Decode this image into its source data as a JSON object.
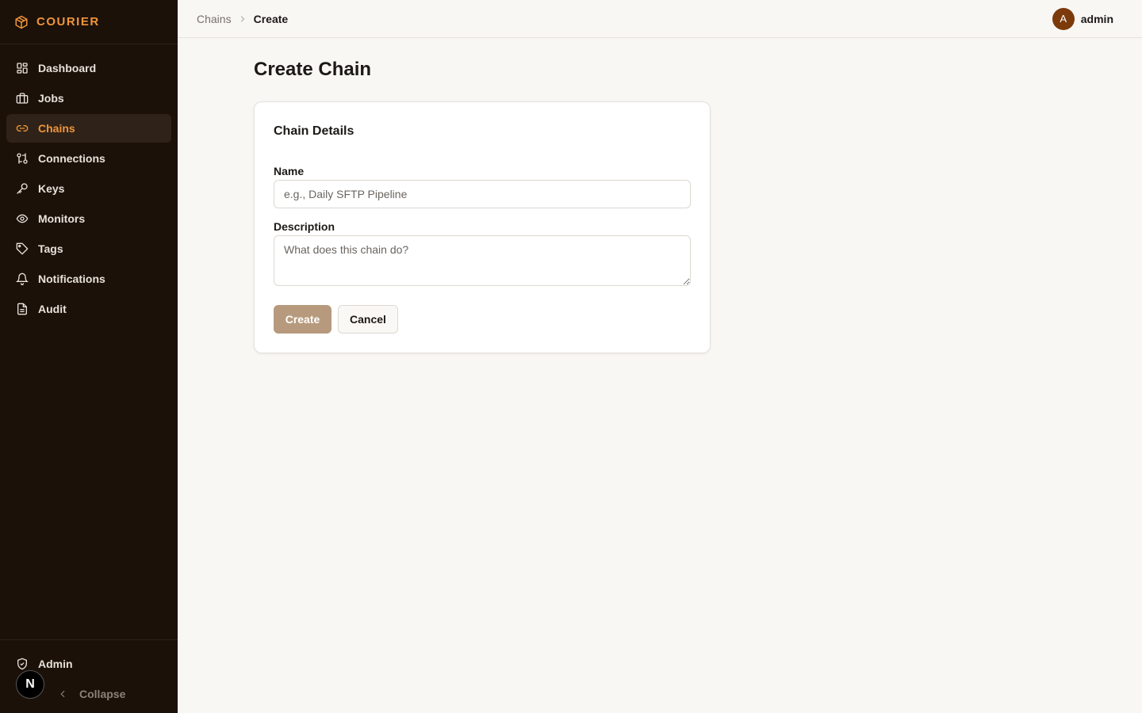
{
  "brand": {
    "name": "COURIER",
    "icon": "package-icon",
    "accent": "#f0953a"
  },
  "sidebar": {
    "items": [
      {
        "label": "Dashboard",
        "icon": "dashboard-icon",
        "active": false
      },
      {
        "label": "Jobs",
        "icon": "briefcase-icon",
        "active": false
      },
      {
        "label": "Chains",
        "icon": "link-icon",
        "active": true
      },
      {
        "label": "Connections",
        "icon": "connections-icon",
        "active": false
      },
      {
        "label": "Keys",
        "icon": "key-icon",
        "active": false
      },
      {
        "label": "Monitors",
        "icon": "eye-icon",
        "active": false
      },
      {
        "label": "Tags",
        "icon": "tag-icon",
        "active": false
      },
      {
        "label": "Notifications",
        "icon": "bell-icon",
        "active": false
      },
      {
        "label": "Audit",
        "icon": "file-text-icon",
        "active": false
      }
    ],
    "admin_label": "Admin",
    "collapse_label": "Collapse",
    "badge_letter": "N"
  },
  "breadcrumb": {
    "parent": "Chains",
    "current": "Create"
  },
  "user": {
    "initial": "A",
    "name": "admin",
    "avatar_color": "#7c3a0b"
  },
  "page": {
    "title": "Create Chain"
  },
  "form": {
    "section_title": "Chain Details",
    "name_label": "Name",
    "name_value": "",
    "name_placeholder": "e.g., Daily SFTP Pipeline",
    "description_label": "Description",
    "description_value": "",
    "description_placeholder": "What does this chain do?",
    "create_label": "Create",
    "cancel_label": "Cancel"
  }
}
